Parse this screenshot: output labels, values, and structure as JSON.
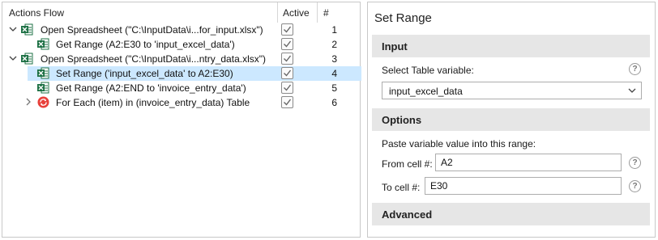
{
  "flow": {
    "columns": {
      "title": "Actions Flow",
      "active": "Active",
      "number": "#"
    },
    "rows": [
      {
        "label": "Open Spreadsheet (\"C:\\InputData\\i...for_input.xlsx\")",
        "number": "1"
      },
      {
        "label": "Get Range (A2:E30 to 'input_excel_data')",
        "number": "2"
      },
      {
        "label": "Open Spreadsheet (\"C:\\InputData\\i...ntry_data.xlsx\")",
        "number": "3"
      },
      {
        "label": "Set Range ('input_excel_data' to A2:E30)",
        "number": "4"
      },
      {
        "label": "Get Range (A2:END to 'invoice_entry_data')",
        "number": "5"
      },
      {
        "label": "For Each (item) in (invoice_entry_data) Table",
        "number": "6"
      }
    ]
  },
  "props": {
    "title": "Set Range",
    "input": {
      "heading": "Input",
      "table_label": "Select Table variable:",
      "table_value": "input_excel_data",
      "help": "?"
    },
    "options": {
      "heading": "Options",
      "paste_label": "Paste variable value into this range:",
      "from_label": "From cell #:",
      "from_value": "A2",
      "to_label": "To cell #:",
      "to_value": "E30",
      "help": "?"
    },
    "advanced": {
      "heading": "Advanced"
    }
  },
  "colors": {
    "selection": "#cce8ff",
    "excel_green": "#1e7145",
    "loop_red": "#e8403a",
    "section_bg": "#e6e6e6"
  }
}
